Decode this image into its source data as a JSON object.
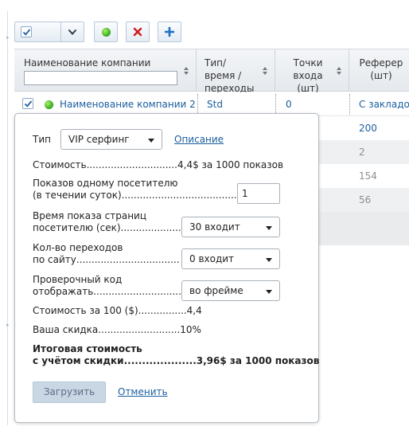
{
  "toolbar": {
    "select_all_checked": true,
    "icons": [
      "checkbox-icon",
      "chevron-down-icon",
      "green-dot-icon",
      "red-x-icon",
      "plus-icon"
    ],
    "colors": {
      "delete": "#d0181a",
      "add": "#1f6fc4",
      "active": "#35b21d"
    }
  },
  "table": {
    "columns": [
      {
        "label": "Наименование компании"
      },
      {
        "label": "Тип/время /переходы"
      },
      {
        "label": "Точки входа (шт)"
      },
      {
        "label": "Реферер (шт)"
      }
    ],
    "filter_value": "",
    "row": {
      "checked": true,
      "name": "Наименование компании 2",
      "type": "Std",
      "entry_points": "0",
      "referer": "С закладо"
    },
    "referer_values": [
      "200",
      "2",
      "154",
      "56"
    ]
  },
  "popup": {
    "type_label": "Тип",
    "type_value": "VIP серфинг",
    "description_link": "Описание",
    "cost_line": "Стоимость..............................4,4$ за 1000 показов",
    "views_label_1": "Показов одному посетителю",
    "views_label_2": "(в течении суток).......................................",
    "views_value": "1",
    "time_label_1": "Время показа страниц",
    "time_label_2": "посетителю (сек).....................",
    "time_value": "30 входит",
    "clicks_label_1": "Кол-во переходов",
    "clicks_label_2": "по сайту..................................",
    "clicks_value": "0 входит",
    "check_label_1": "Проверочный код",
    "check_label_2": "отображать.............................",
    "check_value": "во фрейме",
    "cost100_line": "Стоимость за 100 ($)................4,4",
    "discount_line": "Ваша скидка...........................10%",
    "total_label_1": "Итоговая стоимость",
    "total_label_2": "с учётом скидки....................3,96$ за 1000 показов",
    "load_button": "Загрузить",
    "cancel_link": "Отменить"
  }
}
